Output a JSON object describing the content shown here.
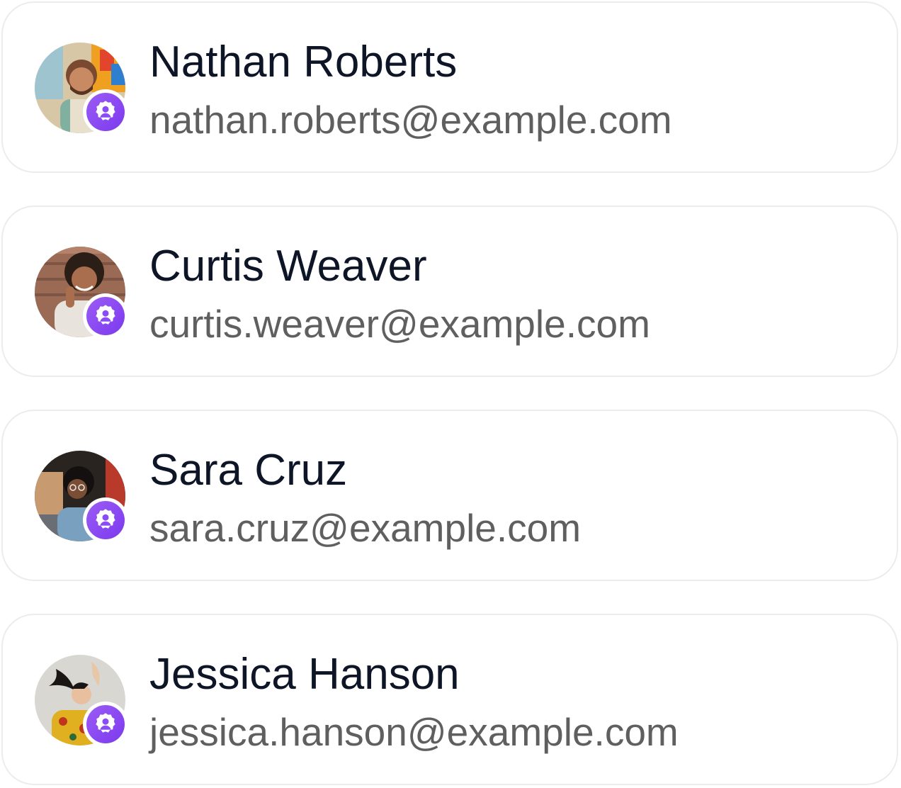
{
  "users": [
    {
      "name": "Nathan Roberts",
      "email": "nathan.roberts@example.com",
      "avatar_icon": "user-photo-icon",
      "badge_icon": "verified-user-badge-icon",
      "avatar_bg": "#d8c7a6",
      "avatar_accent": "#f0a020"
    },
    {
      "name": "Curtis Weaver",
      "email": "curtis.weaver@example.com",
      "avatar_icon": "user-photo-icon",
      "badge_icon": "verified-user-badge-icon",
      "avatar_bg": "#9a6a55",
      "avatar_accent": "#e8e3dc"
    },
    {
      "name": "Sara Cruz",
      "email": "sara.cruz@example.com",
      "avatar_icon": "user-photo-icon",
      "badge_icon": "verified-user-badge-icon",
      "avatar_bg": "#2a2420",
      "avatar_accent": "#b93a2a"
    },
    {
      "name": "Jessica Hanson",
      "email": "jessica.hanson@example.com",
      "avatar_icon": "user-photo-icon",
      "badge_icon": "verified-user-badge-icon",
      "avatar_bg": "#d9d7d2",
      "avatar_accent": "#e0b020"
    }
  ],
  "colors": {
    "badge": "#8b4cf6",
    "name_text": "#0d1526",
    "email_text": "#5f5f5f",
    "card_border": "#ececec"
  }
}
